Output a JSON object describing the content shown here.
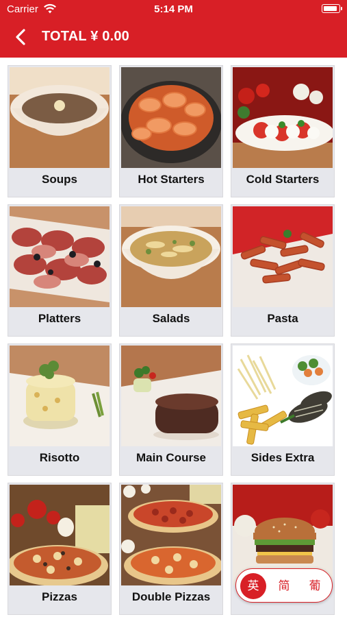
{
  "status_bar": {
    "carrier": "Carrier",
    "time": "5:14 PM"
  },
  "header": {
    "title": "TOTAL ¥ 0.00",
    "back_icon": "chevron-left-icon"
  },
  "colors": {
    "brand_red": "#d81f26",
    "card_bg": "#e6e7ec"
  },
  "categories": [
    {
      "label": "Soups"
    },
    {
      "label": "Hot Starters"
    },
    {
      "label": "Cold Starters"
    },
    {
      "label": "Platters"
    },
    {
      "label": "Salads"
    },
    {
      "label": "Pasta"
    },
    {
      "label": "Risotto"
    },
    {
      "label": "Main Course"
    },
    {
      "label": "Sides Extra"
    },
    {
      "label": "Pizzas"
    },
    {
      "label": "Double Pizzas"
    },
    {
      "label": ""
    }
  ],
  "language_switch": {
    "options": [
      "英",
      "简",
      "葡"
    ],
    "selected": "英"
  }
}
